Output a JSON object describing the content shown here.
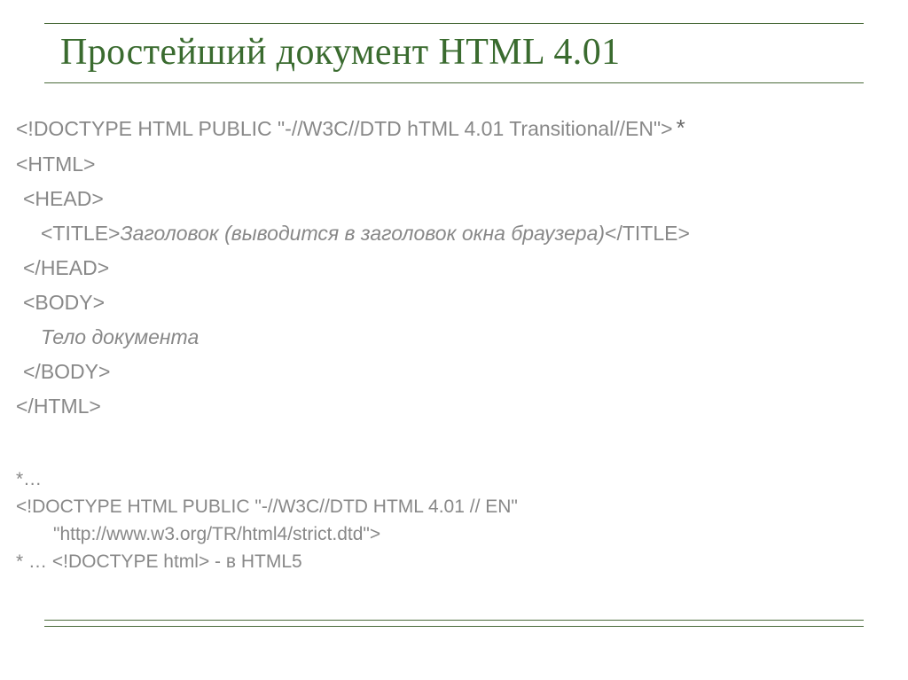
{
  "slide": {
    "title": "Простейший документ HTML 4.01",
    "code": {
      "line1": "<!DOCTYPE HTML PUBLIC \"-//W3C//DTD hTML 4.01 Transitional//EN\">",
      "asterisk": "*",
      "line2": "<HTML>",
      "line3": "<HEAD>",
      "line4_open": "<TITLE>",
      "line4_text": "Заголовок (выводится в заголовок окна браузера)",
      "line4_close": "</TITLE>",
      "line5": "</HEAD>",
      "line6": "<BODY>",
      "line7": "Тело документа",
      "line8": "</BODY>",
      "line9": "</HTML>"
    },
    "footer": {
      "f1": "*…",
      "f2": "<!DOCTYPE  HTML PUBLIC \"-//W3C//DTD HTML 4.01 // EN\"",
      "f3": "\"http://www.w3.org/TR/html4/strict.dtd\">",
      "f4": "* … <!DOCTYPE html> - в HTML5"
    }
  }
}
